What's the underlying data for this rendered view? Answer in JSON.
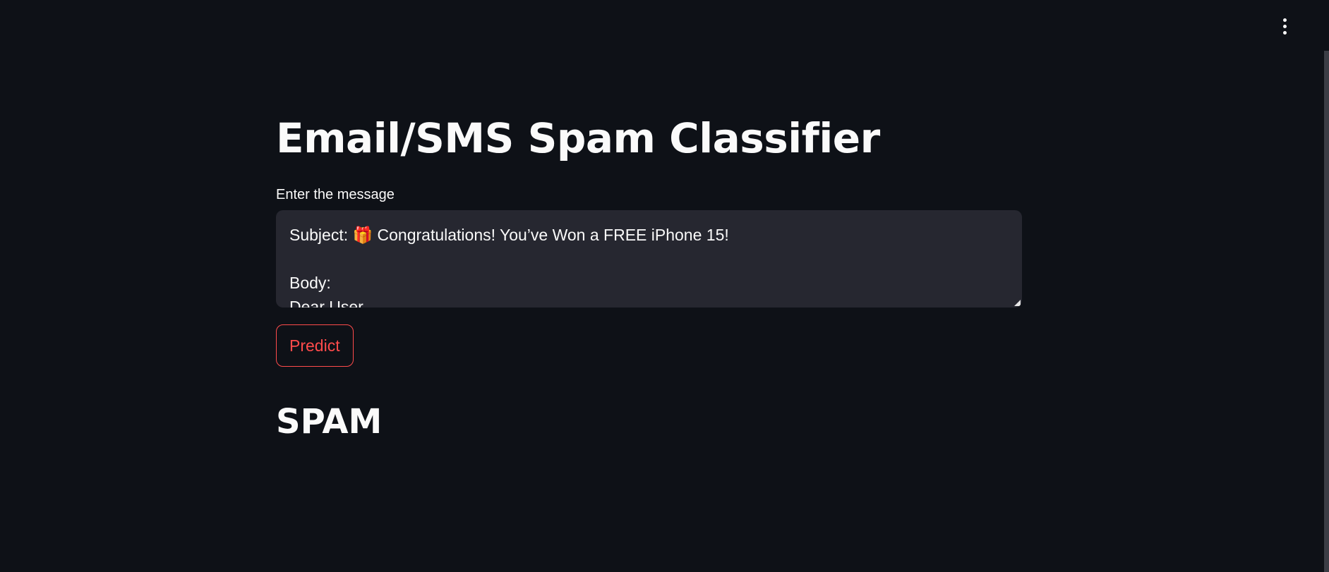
{
  "header": {
    "menu_icon": "vertical-ellipsis-icon"
  },
  "main": {
    "title": "Email/SMS Spam Classifier",
    "input_label": "Enter the message",
    "message_value": "Subject: 🎁 Congratulations! You’ve Won a FREE iPhone 15!\n\nBody:\nDear User,",
    "predict_label": "Predict",
    "result": "SPAM"
  },
  "colors": {
    "background": "#0e1117",
    "input_background": "#262730",
    "accent": "#ff4b4b",
    "text": "#fafafa"
  }
}
